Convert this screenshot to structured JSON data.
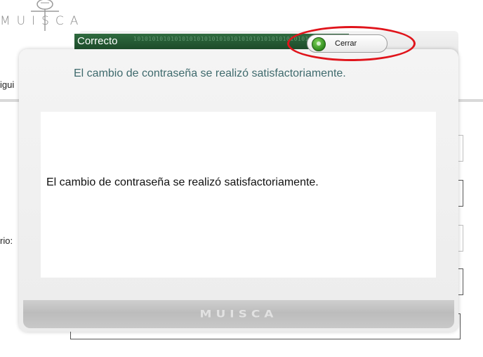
{
  "background": {
    "logo_text": "MUISCA",
    "side_text_1": "igui",
    "side_text_2": "rio:"
  },
  "dialog": {
    "title": "Correcto",
    "title_pattern": "1010101010101010101010101010101010101010101010101010101010101010",
    "subtitle": "El cambio de contraseña se realizó satisfactoriamente.",
    "message": "El cambio de contraseña se realizó satisfactoriamente.",
    "close_label": "Cerrar",
    "footer_brand": "MUISCA"
  },
  "colors": {
    "title_bar": "#2f6b3f",
    "subtitle_text": "#3f6a6d",
    "highlight": "#e0141b",
    "close_icon": "#2f8b1c"
  }
}
